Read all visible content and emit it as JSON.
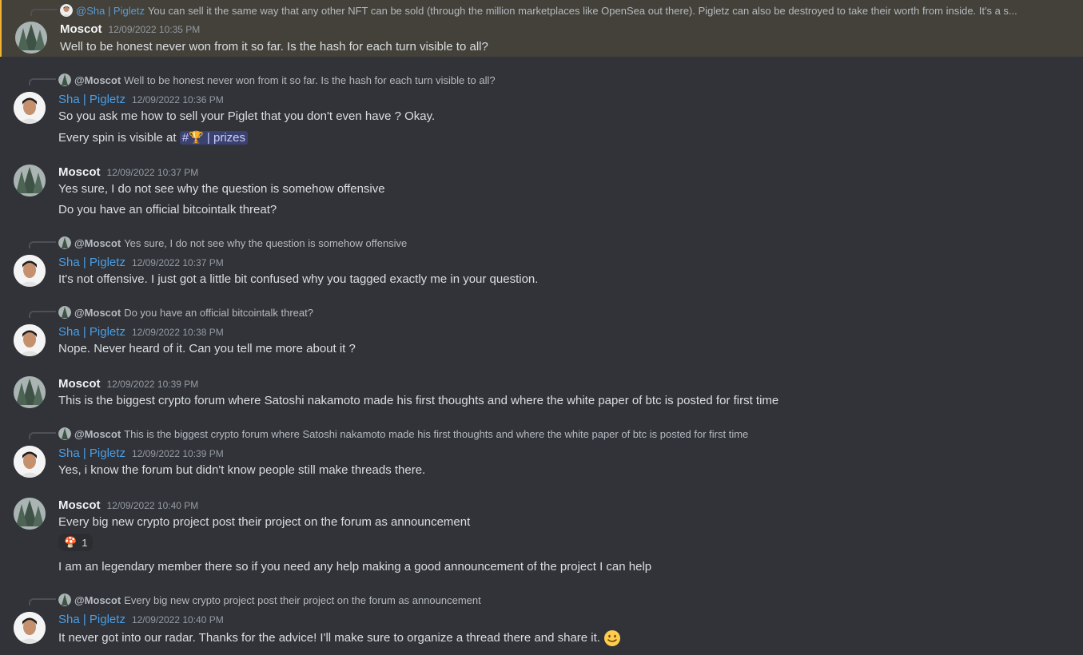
{
  "pinned": {
    "reply_name": "@Sha | Pigletz",
    "reply_text": "You can sell it the same way that any other NFT can be sold (through the million marketplaces like OpenSea out there). Pigletz can also be destroyed to take their worth from inside. It's a s...",
    "author": "Moscot",
    "time": "12/09/2022 10:35 PM",
    "text": "Well to be honest never won from it so far. Is the hash for each turn visible to all?"
  },
  "m2": {
    "reply_name": "@Moscot",
    "reply_text": "Well to be honest never won from it so far. Is the hash for each turn visible to all?",
    "author": "Sha | Pigletz",
    "time": "12/09/2022 10:36 PM",
    "line1": "So you ask me how to sell your Piglet that you don't even have ? Okay.",
    "line2_prefix": "Every spin is visible at",
    "channel": "#🏆 | prizes"
  },
  "m3": {
    "author": "Moscot",
    "time": "12/09/2022 10:37 PM",
    "line1": "Yes sure, I do not see why the question is somehow offensive",
    "line2": "Do you have an official bitcointalk threat?"
  },
  "m4": {
    "reply_name": "@Moscot",
    "reply_text": "Yes sure, I do not see why the question is somehow offensive",
    "author": "Sha | Pigletz",
    "time": "12/09/2022 10:37 PM",
    "line1": "It's not offensive. I just got a little bit confused why you tagged exactly me in your question."
  },
  "m5": {
    "reply_name": "@Moscot",
    "reply_text": "Do you have an official bitcointalk threat?",
    "author": "Sha | Pigletz",
    "time": "12/09/2022 10:38 PM",
    "line1": "Nope. Never heard of it. Can you tell me more about it ?"
  },
  "m6": {
    "author": "Moscot",
    "time": "12/09/2022 10:39 PM",
    "line1": "This is the biggest crypto forum where Satoshi nakamoto made his first thoughts and where the white paper of btc is posted for first time"
  },
  "m7": {
    "reply_name": "@Moscot",
    "reply_text": "This is the biggest crypto forum where Satoshi nakamoto made his first thoughts and where the white paper of btc is posted for first time",
    "author": "Sha | Pigletz",
    "time": "12/09/2022 10:39 PM",
    "line1": "Yes, i know the forum but didn't know people still make threads there."
  },
  "m8": {
    "author": "Moscot",
    "time": "12/09/2022 10:40 PM",
    "line1": "Every big new crypto project post their project on the forum as announcement",
    "reaction_emoji": "🍄",
    "reaction_count": "1",
    "line2": "I am an legendary member there so if you need any help making a good announcement of the project I can help"
  },
  "m9": {
    "reply_name": "@Moscot",
    "reply_text": "Every big new crypto project post their project on the forum as announcement",
    "author": "Sha | Pigletz",
    "time": "12/09/2022 10:40 PM",
    "line1": "It never got into our radar. Thanks for the advice! I'll make sure to organize a thread there and share it."
  },
  "icons": {
    "tree_avatar": "tree-avatar-icon",
    "person_avatar": "person-avatar-icon",
    "smile": "slightly-smiling-face-icon"
  }
}
